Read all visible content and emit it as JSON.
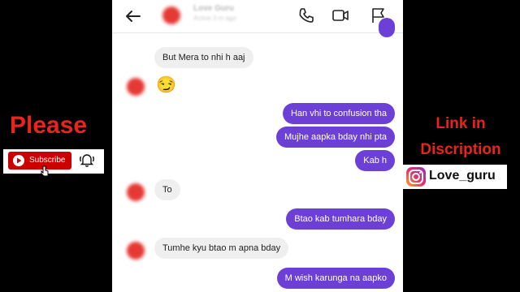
{
  "header": {
    "name": "Love Guru",
    "status": "Active 3 m ago",
    "icons": [
      "back-arrow-icon",
      "phone-icon",
      "video-icon",
      "flag-icon"
    ]
  },
  "messages": [
    {
      "side": "in",
      "text": "But Mera to nhi h aaj"
    },
    {
      "side": "in",
      "text": "😏"
    },
    {
      "side": "out",
      "text": "Han vhi to confusion tha"
    },
    {
      "side": "out",
      "text": "Mujhe aapka bday nhi pta"
    },
    {
      "side": "out",
      "text": "Kab h"
    },
    {
      "side": "in",
      "text": "To"
    },
    {
      "side": "out",
      "text": "Btao kab tumhara bday"
    },
    {
      "side": "in",
      "text": "Tumhe kyu btao m apna bday"
    },
    {
      "side": "out",
      "text": "M wish karunga na aapko"
    }
  ],
  "overlay": {
    "left_text": "Please",
    "subscribe_label": "Subscribe",
    "right_text_line1": "Link in",
    "right_text_line2": "Discription",
    "instagram_handle": "Love_guru"
  },
  "colors": {
    "outgoing_bubble": "#6c3fd6",
    "incoming_bubble": "#efefef",
    "overlay_red": "#e8241d",
    "subscribe_red": "#cc0000"
  }
}
